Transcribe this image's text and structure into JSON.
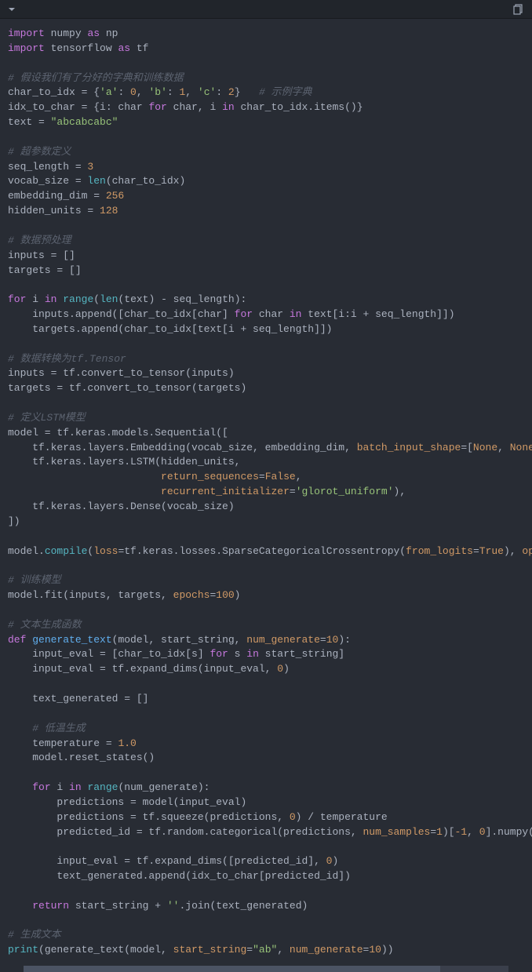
{
  "header": {
    "chevron": "chevron-down",
    "copy": "copy"
  },
  "code": {
    "l1": {
      "kw1": "import",
      "mod1": "numpy",
      "kw2": "as",
      "alias1": "np"
    },
    "l2": {
      "kw1": "import",
      "mod1": "tensorflow",
      "kw2": "as",
      "alias1": "tf"
    },
    "c1": "# 假设我们有了分好的字典和训练数据",
    "l3": {
      "v": "char_to_idx = {",
      "ka": "'a'",
      "va": "0",
      "kb": "'b'",
      "vb": "1",
      "kc": "'c'",
      "vc": "2",
      "close": "}",
      "cm": "# 示例字典"
    },
    "l4": {
      "pre": "idx_to_char = {i: char ",
      "kw1": "for",
      "mid": " char, i ",
      "kw2": "in",
      "post": " char_to_idx.items()}"
    },
    "l5": {
      "v": "text = ",
      "s": "\"abcabcabc\""
    },
    "c2": "# 超参数定义",
    "l6": {
      "v": "seq_length = ",
      "n": "3"
    },
    "l7": {
      "v": "vocab_size = ",
      "fn": "len",
      "args": "(char_to_idx)"
    },
    "l8": {
      "v": "embedding_dim = ",
      "n": "256"
    },
    "l9": {
      "v": "hidden_units = ",
      "n": "128"
    },
    "c3": "# 数据预处理",
    "l10": "inputs = []",
    "l11": "targets = []",
    "l12": {
      "kw1": "for",
      "var": " i ",
      "kw2": "in",
      "sp": " ",
      "fn1": "range",
      "p1": "(",
      "fn2": "len",
      "args": "(text) - seq_length):"
    },
    "l13": {
      "pre": "    inputs.append([char_to_idx[char] ",
      "kw1": "for",
      "mid": " char ",
      "kw2": "in",
      "post": " text[i:i + seq_length]])"
    },
    "l14": "    targets.append(char_to_idx[text[i + seq_length]])",
    "c4": "# 数据转换为tf.Tensor",
    "l15": "inputs = tf.convert_to_tensor(inputs)",
    "l16": "targets = tf.convert_to_tensor(targets)",
    "c5": "# 定义LSTM模型",
    "l17": "model = tf.keras.models.Sequential([",
    "l18": {
      "pre": "    tf.keras.layers.Embedding(vocab_size, embedding_dim, ",
      "p1": "batch_input_shape",
      "eq": "=[",
      "n1": "None",
      "c": ", ",
      "n2": "None",
      "end": "]),"
    },
    "l19": "    tf.keras.layers.LSTM(hidden_units,",
    "l20": {
      "pre": "                         ",
      "p": "return_sequences",
      "eq": "=",
      "v": "False",
      "end": ","
    },
    "l21": {
      "pre": "                         ",
      "p": "recurrent_initializer",
      "eq": "=",
      "v": "'glorot_uniform'",
      "end": "),"
    },
    "l22": "    tf.keras.layers.Dense(vocab_size)",
    "l23": "])",
    "l24": {
      "pre": "model.",
      "fn": "compile",
      "args1": "(",
      "p1": "loss",
      "eq1": "=tf.keras.losses.SparseCategoricalCrossentropy(",
      "p2": "from_logits",
      "eq2": "=",
      "v2": "True",
      "args2": "), ",
      "p3": "optimizer",
      "eq3": "=",
      "cut": "\""
    },
    "c6": "# 训练模型",
    "l25": {
      "pre": "model.fit(inputs, targets, ",
      "p": "epochs",
      "eq": "=",
      "n": "100",
      "end": ")"
    },
    "c7": "# 文本生成函数",
    "l26": {
      "kw": "def",
      "sp": " ",
      "fn": "generate_text",
      "args": "(model, start_string, ",
      "p": "num_generate",
      "eq": "=",
      "n": "10",
      "end": "):"
    },
    "l27": {
      "pre": "    input_eval = [char_to_idx[s] ",
      "kw1": "for",
      "mid": " s ",
      "kw2": "in",
      "post": " start_string]"
    },
    "l28": {
      "pre": "    input_eval = tf.expand_dims(input_eval, ",
      "n": "0",
      "end": ")"
    },
    "l29": "    text_generated = []",
    "c8": "    # 低温生成",
    "l30": {
      "pre": "    temperature = ",
      "n": "1.0"
    },
    "l31": "    model.reset_states()",
    "l32": {
      "pre": "    ",
      "kw1": "for",
      "var": " i ",
      "kw2": "in",
      "sp": " ",
      "fn": "range",
      "args": "(num_generate):"
    },
    "l33": "        predictions = model(input_eval)",
    "l34": {
      "pre": "        predictions = tf.squeeze(predictions, ",
      "n": "0",
      "end": ") / temperature"
    },
    "l35": {
      "pre": "        predicted_id = tf.random.categorical(predictions, ",
      "p": "num_samples",
      "eq": "=",
      "n1": "1",
      "mid": ")[",
      "n2": "-1",
      "c": ", ",
      "n3": "0",
      "end": "].numpy()"
    },
    "l36": {
      "pre": "        input_eval = tf.expand_dims([predicted_id], ",
      "n": "0",
      "end": ")"
    },
    "l37": "        text_generated.append(idx_to_char[predicted_id])",
    "l38": {
      "pre": "    ",
      "kw": "return",
      "mid": " start_string + ",
      "s": "''",
      "end": ".join(text_generated)"
    },
    "c9": "# 生成文本",
    "l39": {
      "fn": "print",
      "pre": "(generate_text(model, ",
      "p1": "start_string",
      "eq1": "=",
      "s": "\"ab\"",
      "c": ", ",
      "p2": "num_generate",
      "eq2": "=",
      "n": "10",
      "end": "))"
    }
  }
}
